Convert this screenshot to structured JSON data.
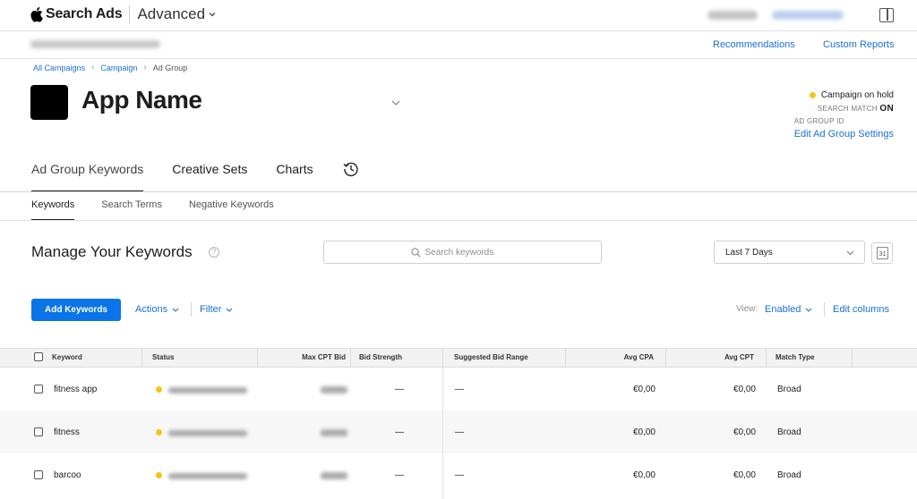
{
  "topbar": {
    "brand_name": "Search Ads",
    "mode": "Advanced"
  },
  "subbar": {
    "recommendations": "Recommendations",
    "custom_reports": "Custom Reports"
  },
  "breadcrumb": {
    "items": [
      "All Campaigns",
      "Campaign",
      "Ad Group"
    ]
  },
  "app": {
    "name": "App Name"
  },
  "status": {
    "campaign_status": "Campaign on hold",
    "status_color": "#f5c518",
    "search_match_label": "SEARCH MATCH",
    "search_match_value": "ON",
    "ad_group_id_label": "AD GROUP ID",
    "edit_settings": "Edit Ad Group Settings"
  },
  "main_tabs": [
    {
      "label": "Ad Group Keywords",
      "active": true
    },
    {
      "label": "Creative Sets",
      "active": false
    },
    {
      "label": "Charts",
      "active": false
    }
  ],
  "sub_tabs": [
    {
      "label": "Keywords",
      "active": true
    },
    {
      "label": "Search Terms",
      "active": false
    },
    {
      "label": "Negative Keywords",
      "active": false
    }
  ],
  "manage": {
    "title": "Manage Your Keywords",
    "help": "?",
    "search_placeholder": "Search keywords",
    "date_range": "Last 7 Days",
    "calendar_day": "31"
  },
  "toolbar": {
    "add_keywords": "Add Keywords",
    "actions": "Actions",
    "filter": "Filter",
    "view_label": "View:",
    "view_value": "Enabled",
    "edit_columns": "Edit columns"
  },
  "table": {
    "headers": {
      "keyword": "Keyword",
      "status": "Status",
      "max_cpt_bid": "Max CPT Bid",
      "bid_strength": "Bid Strength",
      "suggested_bid_range": "Suggested Bid Range",
      "avg_cpa": "Avg CPA",
      "avg_cpt": "Avg CPT",
      "match_type": "Match Type"
    },
    "rows": [
      {
        "keyword": "fitness app",
        "bid_strength": "—",
        "suggested_bid_range": "—",
        "avg_cpa": "€0,00",
        "avg_cpt": "€0,00",
        "match_type": "Broad"
      },
      {
        "keyword": "fitness",
        "bid_strength": "—",
        "suggested_bid_range": "—",
        "avg_cpa": "€0,00",
        "avg_cpt": "€0,00",
        "match_type": "Broad"
      },
      {
        "keyword": "barcoo",
        "bid_strength": "—",
        "suggested_bid_range": "—",
        "avg_cpa": "€0,00",
        "avg_cpt": "€0,00",
        "match_type": "Broad"
      }
    ]
  },
  "colors": {
    "accent": "#0a74e8",
    "link": "#1a6fd6",
    "status_dot": "#f5c518"
  }
}
